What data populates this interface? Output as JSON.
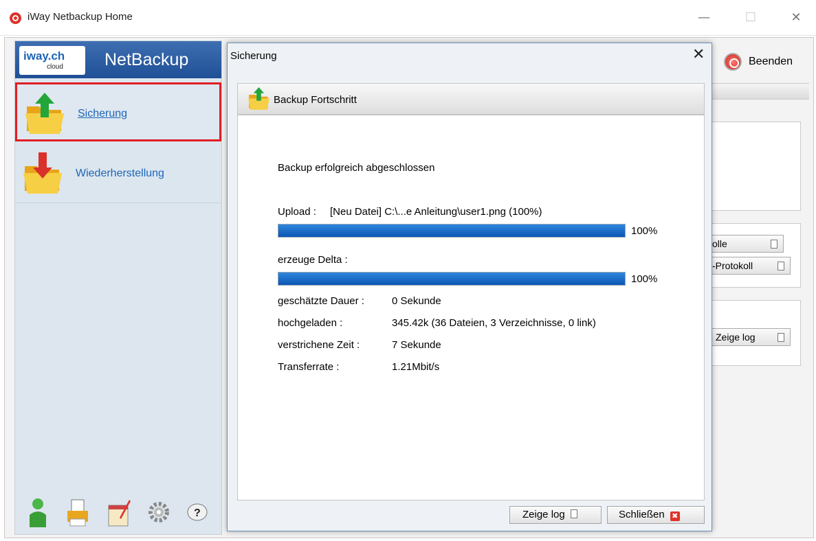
{
  "app": {
    "title": "iWay Netbackup Home"
  },
  "window_controls": {
    "minimize": "—",
    "maximize": "☐",
    "close": "✕"
  },
  "brand": {
    "logo_main": "iway.ch",
    "logo_sub": "cloud",
    "name": "NetBackup"
  },
  "sidebar": {
    "items": [
      {
        "label": "Sicherung"
      },
      {
        "label": "Wiederherstellung"
      }
    ],
    "bottom_icons": [
      "user-icon",
      "printer-icon",
      "calendar-edit-icon",
      "settings-gear-icon",
      "help-icon"
    ]
  },
  "background": {
    "beenden": "Beenden",
    "buttons": [
      "kolle",
      "s-Protokoll",
      "Zeige log"
    ]
  },
  "dialog": {
    "title": "Sicherung",
    "close": "✕",
    "header": "Backup Fortschritt",
    "status": "Backup erfolgreich abgeschlossen",
    "upload_label": "Upload :",
    "upload_file": "[Neu Datei] C:\\...e Anleitung\\user1.png (100%)",
    "upload_progress": 100,
    "upload_pct": "100%",
    "delta_label": "erzeuge Delta :",
    "delta_progress": 100,
    "delta_pct": "100%",
    "stats": [
      {
        "label": "geschätzte Dauer :",
        "value": "0 Sekunde"
      },
      {
        "label": "hochgeladen :",
        "value": "345.42k (36 Dateien, 3 Verzeichnisse, 0 link)"
      },
      {
        "label": "verstrichene  Zeit :",
        "value": "7 Sekunde"
      },
      {
        "label": "Transferrate :",
        "value": "1.21Mbit/s"
      }
    ],
    "buttons": {
      "log": "Zeige log",
      "close": "Schließen",
      "close_icon": "✖"
    }
  },
  "colors": {
    "accent": "#1d65b8",
    "highlight": "#e21d24",
    "progress": "#0b56b4"
  }
}
